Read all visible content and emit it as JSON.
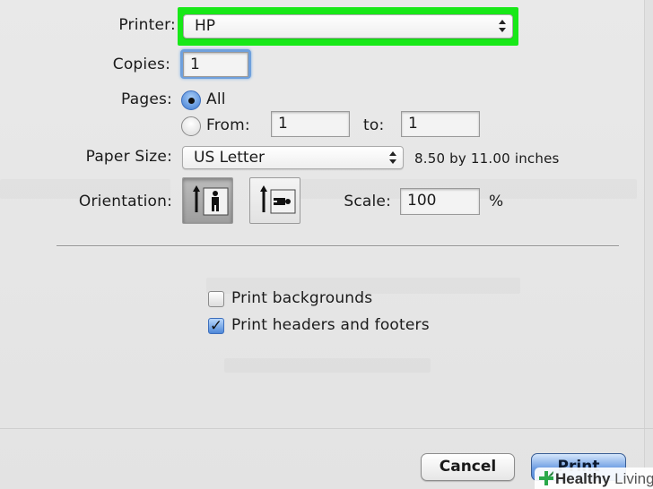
{
  "dialog": {
    "printer": {
      "label": "Printer:",
      "value": "HP"
    },
    "copies": {
      "label": "Copies:",
      "value": "1"
    },
    "pages": {
      "label": "Pages:",
      "all_label": "All",
      "from_label": "From:",
      "from_value": "1",
      "to_label": "to:",
      "to_value": "1",
      "selected": "All"
    },
    "paper_size": {
      "label": "Paper Size:",
      "value": "US Letter",
      "dimensions": "8.50 by 11.00 inches"
    },
    "orientation": {
      "label": "Orientation:",
      "options": [
        {
          "name": "portrait",
          "selected": true
        },
        {
          "name": "landscape",
          "selected": false
        }
      ]
    },
    "scale": {
      "label": "Scale:",
      "value": "100",
      "unit": "%"
    },
    "options": [
      {
        "label": "Print backgrounds",
        "checked": false
      },
      {
        "label": "Print headers and footers",
        "checked": true
      }
    ],
    "buttons": {
      "cancel": "Cancel",
      "print": "Print"
    },
    "highlight_color": "#18e818"
  },
  "watermark": {
    "part1": "Healthy",
    "part2": " Living",
    "icon": "plus-leaf-icon"
  }
}
